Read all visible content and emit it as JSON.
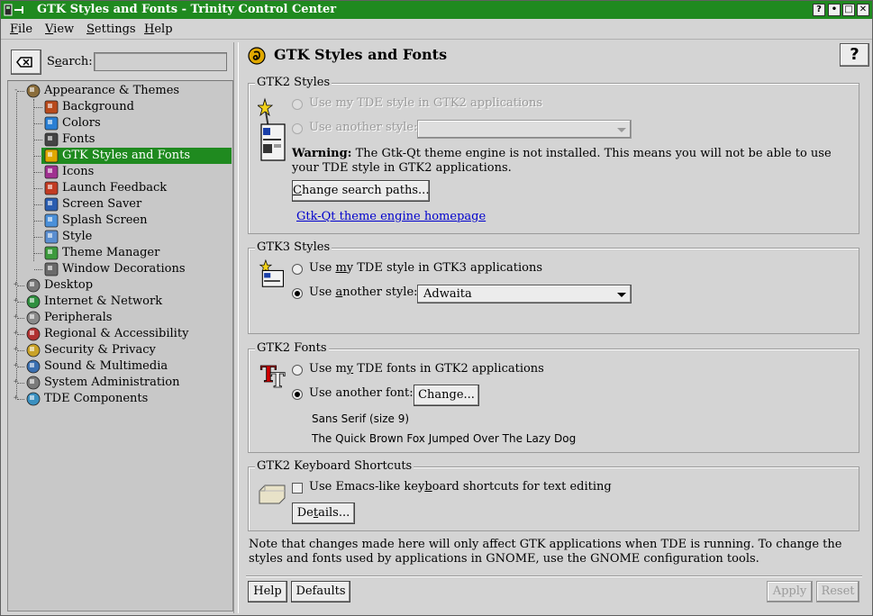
{
  "window": {
    "title": "GTK Styles and Fonts - Trinity Control Center",
    "buttons": [
      "?",
      "•",
      "□",
      "✕"
    ]
  },
  "menubar": {
    "items": [
      {
        "label": "File",
        "mnemonic": "F",
        "rest": "ile"
      },
      {
        "label": "View",
        "mnemonic": "V",
        "rest": "iew"
      },
      {
        "label": "Settings",
        "mnemonic": "S",
        "rest": "ettings"
      },
      {
        "label": "Help",
        "mnemonic": "H",
        "rest": "elp"
      }
    ]
  },
  "sidebar": {
    "search_label_a": "S",
    "search_label_u": "e",
    "search_label_b": "arch:",
    "search_value": "",
    "tree": [
      {
        "label": "Appearance & Themes",
        "level": 0,
        "expander": "-",
        "icon": "appearance-icon",
        "color": "#8a6d3b"
      },
      {
        "label": "Background",
        "level": 1,
        "icon": "background-icon",
        "color": "#b84a1c"
      },
      {
        "label": "Colors",
        "level": 1,
        "icon": "colors-icon",
        "color": "#2a7fd4"
      },
      {
        "label": "Fonts",
        "level": 1,
        "icon": "fonts-icon",
        "color": "#444444"
      },
      {
        "label": "GTK Styles and Fonts",
        "level": 1,
        "icon": "gtk-icon",
        "color": "#e0a800",
        "selected": true
      },
      {
        "label": "Icons",
        "level": 1,
        "icon": "icons-icon",
        "color": "#a03090"
      },
      {
        "label": "Launch Feedback",
        "level": 1,
        "icon": "launch-feedback-icon",
        "color": "#c23b22"
      },
      {
        "label": "Screen Saver",
        "level": 1,
        "icon": "screen-saver-icon",
        "color": "#2a5db0"
      },
      {
        "label": "Splash Screen",
        "level": 1,
        "icon": "splash-screen-icon",
        "color": "#4a90d9"
      },
      {
        "label": "Style",
        "level": 1,
        "icon": "style-icon",
        "color": "#5a8ed0"
      },
      {
        "label": "Theme Manager",
        "level": 1,
        "icon": "theme-manager-icon",
        "color": "#3c9a3c"
      },
      {
        "label": "Window Decorations",
        "level": 1,
        "icon": "window-decorations-icon",
        "color": "#6a6a6a"
      },
      {
        "label": "Desktop",
        "level": 0,
        "expander": "+",
        "icon": "desktop-icon",
        "color": "#777777"
      },
      {
        "label": "Internet & Network",
        "level": 0,
        "expander": "+",
        "icon": "internet-network-icon",
        "color": "#2f8f3f"
      },
      {
        "label": "Peripherals",
        "level": 0,
        "expander": "+",
        "icon": "peripherals-icon",
        "color": "#8a8a8a"
      },
      {
        "label": "Regional & Accessibility",
        "level": 0,
        "expander": "+",
        "icon": "regional-accessibility-icon",
        "color": "#b03030"
      },
      {
        "label": "Security & Privacy",
        "level": 0,
        "expander": "+",
        "icon": "security-privacy-icon",
        "color": "#c9a227"
      },
      {
        "label": "Sound & Multimedia",
        "level": 0,
        "expander": "+",
        "icon": "sound-multimedia-icon",
        "color": "#3a6fb0"
      },
      {
        "label": "System Administration",
        "level": 0,
        "expander": "+",
        "icon": "system-administration-icon",
        "color": "#7a7a7a"
      },
      {
        "label": "TDE Components",
        "level": 0,
        "expander": "+",
        "icon": "tde-components-icon",
        "color": "#3a90c0"
      }
    ]
  },
  "main": {
    "title": "GTK Styles and Fonts",
    "help_button": "?",
    "gtk2_styles": {
      "title": "GTK2 Styles",
      "opt_tde": "Use my TDE style in GTK2 applications",
      "opt_other": "Use another style:",
      "combo_value": "",
      "warning_bold": "Warning:",
      "warning_text": " The Gtk-Qt theme engine is not installed. This means you will not be able to use your TDE style in GTK2 applications.",
      "change_paths_button_a": "C",
      "change_paths_button_b": "hange search paths...",
      "homepage_link": "Gtk-Qt theme engine homepage"
    },
    "gtk3_styles": {
      "title": "GTK3 Styles",
      "opt_tde_a": "Use ",
      "opt_tde_u": "m",
      "opt_tde_b": "y TDE style in GTK3 applications",
      "opt_other_a": "Use ",
      "opt_other_u": "a",
      "opt_other_b": "nother style:",
      "combo_value": "Adwaita"
    },
    "gtk2_fonts": {
      "title": "GTK2 Fonts",
      "opt_tde_a": "Use m",
      "opt_tde_u": "y",
      "opt_tde_b": " TDE fonts in GTK2 applications",
      "opt_other": "Use another font:",
      "change_button": "Change...",
      "font_name": "Sans Serif (size 9)",
      "font_sample": "The Quick Brown Fox Jumped Over The Lazy Dog"
    },
    "gtk2_shortcuts": {
      "title": "GTK2 Keyboard Shortcuts",
      "checkbox_a": "Use Emacs-like key",
      "checkbox_u": "b",
      "checkbox_b": "oard shortcuts for text editing",
      "details_button_a": "De",
      "details_button_u": "t",
      "details_button_b": "ails..."
    },
    "note": "Note that changes made here will only affect GTK applications when TDE is running.  To change the styles and fonts used by applications in GNOME, use the GNOME configuration tools.",
    "footer": {
      "help": "Help",
      "defaults": "Defaults",
      "apply": "Apply",
      "reset": "Reset"
    }
  }
}
